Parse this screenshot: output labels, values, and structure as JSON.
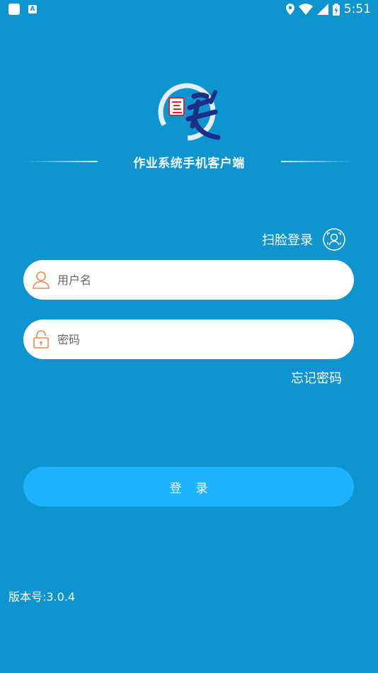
{
  "status_bar": {
    "time": "5:51"
  },
  "app": {
    "subtitle": "作业系统手机客户端"
  },
  "face_login": {
    "label": "扫脸登录"
  },
  "username": {
    "placeholder": "用户名",
    "value": ""
  },
  "password": {
    "placeholder": "密码",
    "value": ""
  },
  "forgot_password": {
    "label": "忘记密码"
  },
  "login_button": {
    "label": "登录"
  },
  "version": {
    "text": "版本号:3.0.4"
  },
  "colors": {
    "background": "#0e95cf",
    "button": "#1fb2ff",
    "icon_accent": "#ef8a4d"
  }
}
